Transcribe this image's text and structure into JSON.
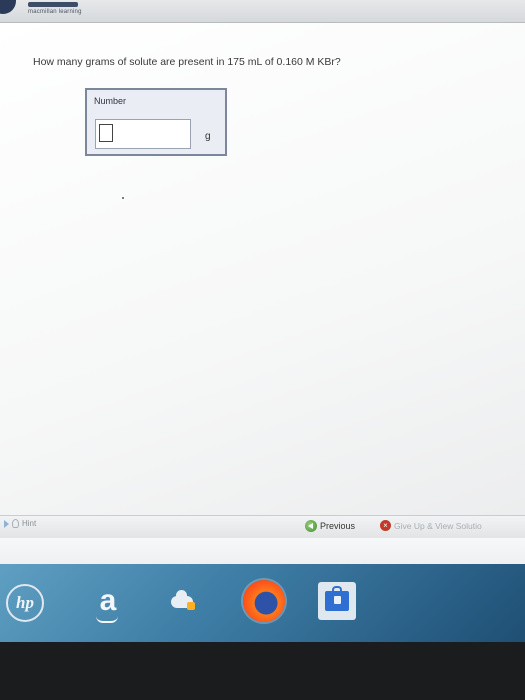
{
  "header": {
    "brand_text": "macmillan learning"
  },
  "question": {
    "text": "How many grams of solute are present in 175 mL of 0.160 M KBr?"
  },
  "answer": {
    "label": "Number",
    "value": "",
    "unit": "g"
  },
  "footer": {
    "hint_label": "Hint",
    "previous_label": "Previous",
    "giveup_label": "Give Up & View Solutio"
  },
  "taskbar": {
    "icons": [
      "hp-logo-icon",
      "amazon-icon",
      "cloud-storage-icon",
      "firefox-icon",
      "store-icon"
    ],
    "hp_text": "hp",
    "amazon_text": "a"
  },
  "colors": {
    "answer_border": "#7c8799",
    "answer_bg": "#eaedf3",
    "previous_icon": "#3b8b2d",
    "giveup_icon": "#c0392b",
    "taskbar": "#3f7fa7",
    "bezel": "#1b1c1e"
  }
}
